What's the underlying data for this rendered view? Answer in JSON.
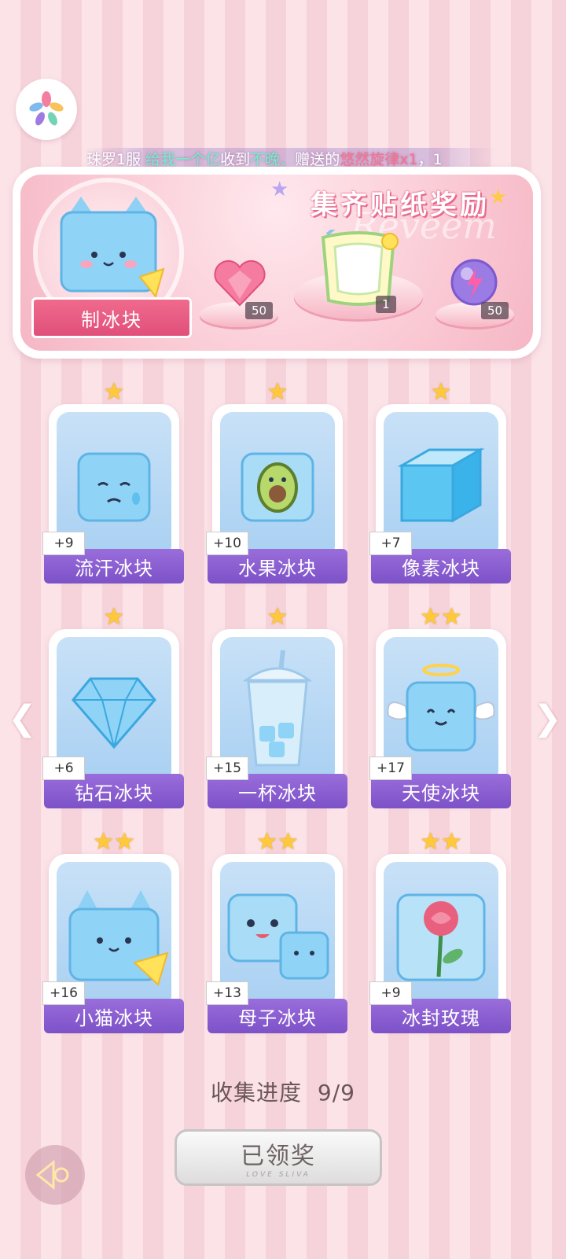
{
  "ticker": {
    "p1": "珠罗1服 ",
    "p2": "给我一个亿",
    "p3": "收到",
    "p4": "不晚、",
    "p5": "赠送的",
    "p6": "悠然旋律x1",
    "p7": "，1"
  },
  "banner": {
    "title": "集齐贴纸奖励",
    "watermark": "Reveem",
    "main_prize_label": "制冰块",
    "rewards": [
      {
        "icon": "heart-gem-icon",
        "qty": "50"
      },
      {
        "icon": "lemonade-frame-icon",
        "qty": "1"
      },
      {
        "icon": "lightning-orb-icon",
        "qty": "50"
      }
    ]
  },
  "stickers": [
    {
      "name": "流汗冰块",
      "bonus": "+9",
      "stars": "★",
      "icon": "sweating-ice-cube-icon"
    },
    {
      "name": "水果冰块",
      "bonus": "+10",
      "stars": "★",
      "icon": "avocado-ice-cube-icon"
    },
    {
      "name": "像素冰块",
      "bonus": "+7",
      "stars": "★",
      "icon": "pixel-ice-cube-icon"
    },
    {
      "name": "钻石冰块",
      "bonus": "+6",
      "stars": "★",
      "icon": "diamond-ice-icon"
    },
    {
      "name": "一杯冰块",
      "bonus": "+15",
      "stars": "★",
      "icon": "cup-of-ice-icon"
    },
    {
      "name": "天使冰块",
      "bonus": "+17",
      "stars": "★★",
      "icon": "angel-ice-cube-icon"
    },
    {
      "name": "小猫冰块",
      "bonus": "+16",
      "stars": "★★",
      "icon": "cat-ice-cube-icon"
    },
    {
      "name": "母子冰块",
      "bonus": "+13",
      "stars": "★★",
      "icon": "mother-child-ice-cube-icon"
    },
    {
      "name": "冰封玫瑰",
      "bonus": "+9",
      "stars": "★★",
      "icon": "frozen-rose-icon"
    }
  ],
  "progress": {
    "label": "收集进度",
    "value": "9/9"
  },
  "claim_button": {
    "label": "已领奖",
    "subtitle": "LOVE SLIVA"
  },
  "colors": {
    "card_label": "#8a5dd0",
    "banner_pink": "#f7bccb",
    "title_pink": "#e86a8e"
  }
}
